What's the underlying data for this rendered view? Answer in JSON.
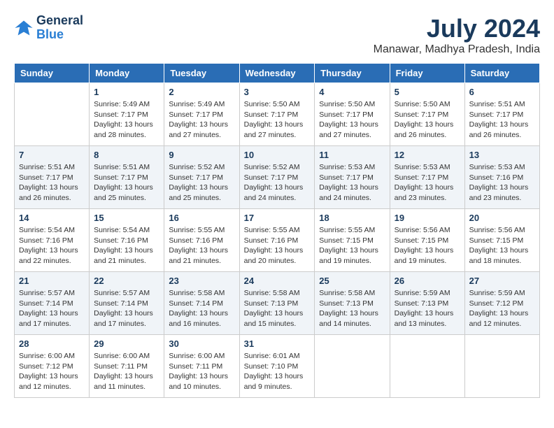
{
  "logo": {
    "line1": "General",
    "line2": "Blue"
  },
  "title": "July 2024",
  "subtitle": "Manawar, Madhya Pradesh, India",
  "days_of_week": [
    "Sunday",
    "Monday",
    "Tuesday",
    "Wednesday",
    "Thursday",
    "Friday",
    "Saturday"
  ],
  "weeks": [
    [
      {
        "day": "",
        "sunrise": "",
        "sunset": "",
        "daylight": ""
      },
      {
        "day": "1",
        "sunrise": "Sunrise: 5:49 AM",
        "sunset": "Sunset: 7:17 PM",
        "daylight": "Daylight: 13 hours and 28 minutes."
      },
      {
        "day": "2",
        "sunrise": "Sunrise: 5:49 AM",
        "sunset": "Sunset: 7:17 PM",
        "daylight": "Daylight: 13 hours and 27 minutes."
      },
      {
        "day": "3",
        "sunrise": "Sunrise: 5:50 AM",
        "sunset": "Sunset: 7:17 PM",
        "daylight": "Daylight: 13 hours and 27 minutes."
      },
      {
        "day": "4",
        "sunrise": "Sunrise: 5:50 AM",
        "sunset": "Sunset: 7:17 PM",
        "daylight": "Daylight: 13 hours and 27 minutes."
      },
      {
        "day": "5",
        "sunrise": "Sunrise: 5:50 AM",
        "sunset": "Sunset: 7:17 PM",
        "daylight": "Daylight: 13 hours and 26 minutes."
      },
      {
        "day": "6",
        "sunrise": "Sunrise: 5:51 AM",
        "sunset": "Sunset: 7:17 PM",
        "daylight": "Daylight: 13 hours and 26 minutes."
      }
    ],
    [
      {
        "day": "7",
        "sunrise": "Sunrise: 5:51 AM",
        "sunset": "Sunset: 7:17 PM",
        "daylight": "Daylight: 13 hours and 26 minutes."
      },
      {
        "day": "8",
        "sunrise": "Sunrise: 5:51 AM",
        "sunset": "Sunset: 7:17 PM",
        "daylight": "Daylight: 13 hours and 25 minutes."
      },
      {
        "day": "9",
        "sunrise": "Sunrise: 5:52 AM",
        "sunset": "Sunset: 7:17 PM",
        "daylight": "Daylight: 13 hours and 25 minutes."
      },
      {
        "day": "10",
        "sunrise": "Sunrise: 5:52 AM",
        "sunset": "Sunset: 7:17 PM",
        "daylight": "Daylight: 13 hours and 24 minutes."
      },
      {
        "day": "11",
        "sunrise": "Sunrise: 5:53 AM",
        "sunset": "Sunset: 7:17 PM",
        "daylight": "Daylight: 13 hours and 24 minutes."
      },
      {
        "day": "12",
        "sunrise": "Sunrise: 5:53 AM",
        "sunset": "Sunset: 7:17 PM",
        "daylight": "Daylight: 13 hours and 23 minutes."
      },
      {
        "day": "13",
        "sunrise": "Sunrise: 5:53 AM",
        "sunset": "Sunset: 7:16 PM",
        "daylight": "Daylight: 13 hours and 23 minutes."
      }
    ],
    [
      {
        "day": "14",
        "sunrise": "Sunrise: 5:54 AM",
        "sunset": "Sunset: 7:16 PM",
        "daylight": "Daylight: 13 hours and 22 minutes."
      },
      {
        "day": "15",
        "sunrise": "Sunrise: 5:54 AM",
        "sunset": "Sunset: 7:16 PM",
        "daylight": "Daylight: 13 hours and 21 minutes."
      },
      {
        "day": "16",
        "sunrise": "Sunrise: 5:55 AM",
        "sunset": "Sunset: 7:16 PM",
        "daylight": "Daylight: 13 hours and 21 minutes."
      },
      {
        "day": "17",
        "sunrise": "Sunrise: 5:55 AM",
        "sunset": "Sunset: 7:16 PM",
        "daylight": "Daylight: 13 hours and 20 minutes."
      },
      {
        "day": "18",
        "sunrise": "Sunrise: 5:55 AM",
        "sunset": "Sunset: 7:15 PM",
        "daylight": "Daylight: 13 hours and 19 minutes."
      },
      {
        "day": "19",
        "sunrise": "Sunrise: 5:56 AM",
        "sunset": "Sunset: 7:15 PM",
        "daylight": "Daylight: 13 hours and 19 minutes."
      },
      {
        "day": "20",
        "sunrise": "Sunrise: 5:56 AM",
        "sunset": "Sunset: 7:15 PM",
        "daylight": "Daylight: 13 hours and 18 minutes."
      }
    ],
    [
      {
        "day": "21",
        "sunrise": "Sunrise: 5:57 AM",
        "sunset": "Sunset: 7:14 PM",
        "daylight": "Daylight: 13 hours and 17 minutes."
      },
      {
        "day": "22",
        "sunrise": "Sunrise: 5:57 AM",
        "sunset": "Sunset: 7:14 PM",
        "daylight": "Daylight: 13 hours and 17 minutes."
      },
      {
        "day": "23",
        "sunrise": "Sunrise: 5:58 AM",
        "sunset": "Sunset: 7:14 PM",
        "daylight": "Daylight: 13 hours and 16 minutes."
      },
      {
        "day": "24",
        "sunrise": "Sunrise: 5:58 AM",
        "sunset": "Sunset: 7:13 PM",
        "daylight": "Daylight: 13 hours and 15 minutes."
      },
      {
        "day": "25",
        "sunrise": "Sunrise: 5:58 AM",
        "sunset": "Sunset: 7:13 PM",
        "daylight": "Daylight: 13 hours and 14 minutes."
      },
      {
        "day": "26",
        "sunrise": "Sunrise: 5:59 AM",
        "sunset": "Sunset: 7:13 PM",
        "daylight": "Daylight: 13 hours and 13 minutes."
      },
      {
        "day": "27",
        "sunrise": "Sunrise: 5:59 AM",
        "sunset": "Sunset: 7:12 PM",
        "daylight": "Daylight: 13 hours and 12 minutes."
      }
    ],
    [
      {
        "day": "28",
        "sunrise": "Sunrise: 6:00 AM",
        "sunset": "Sunset: 7:12 PM",
        "daylight": "Daylight: 13 hours and 12 minutes."
      },
      {
        "day": "29",
        "sunrise": "Sunrise: 6:00 AM",
        "sunset": "Sunset: 7:11 PM",
        "daylight": "Daylight: 13 hours and 11 minutes."
      },
      {
        "day": "30",
        "sunrise": "Sunrise: 6:00 AM",
        "sunset": "Sunset: 7:11 PM",
        "daylight": "Daylight: 13 hours and 10 minutes."
      },
      {
        "day": "31",
        "sunrise": "Sunrise: 6:01 AM",
        "sunset": "Sunset: 7:10 PM",
        "daylight": "Daylight: 13 hours and 9 minutes."
      },
      {
        "day": "",
        "sunrise": "",
        "sunset": "",
        "daylight": ""
      },
      {
        "day": "",
        "sunrise": "",
        "sunset": "",
        "daylight": ""
      },
      {
        "day": "",
        "sunrise": "",
        "sunset": "",
        "daylight": ""
      }
    ]
  ]
}
